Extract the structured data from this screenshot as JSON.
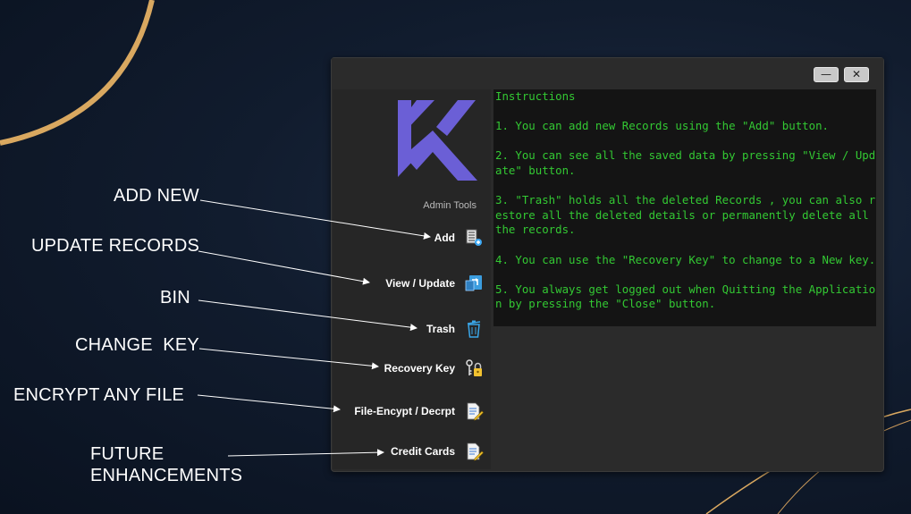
{
  "callouts": {
    "add_new": "ADD NEW",
    "update_records": "UPDATE RECORDS",
    "bin": "BIN",
    "change_key": "CHANGE  KEY",
    "encrypt_any_file": "ENCRYPT ANY FILE",
    "future_enhancements": "FUTURE ENHANCEMENTS"
  },
  "window": {
    "minimize_label": "—",
    "close_label": "✕"
  },
  "sidebar": {
    "logo_icon": "k-logo-icon",
    "admin_label": "Admin Tools",
    "items": [
      {
        "label": "Add",
        "icon": "add-record-icon"
      },
      {
        "label": "View / Update",
        "icon": "view-update-icon"
      },
      {
        "label": "Trash",
        "icon": "trash-icon"
      },
      {
        "label": "Recovery Key",
        "icon": "key-lock-icon"
      },
      {
        "label": "File-Encypt / Decrpt",
        "icon": "file-edit-icon"
      },
      {
        "label": "Credit Cards",
        "icon": "file-edit-icon"
      }
    ]
  },
  "instructions": {
    "heading": "Instructions",
    "lines": [
      "1. You can add new Records using the \"Add\" button.",
      "2. You can see all the saved data by pressing \"View / Update\" button.",
      "3. \"Trash\" holds all the deleted Records , you can also restore all the deleted details or permanently delete all the records.",
      "4. You can use the \"Recovery Key\" to change to a New key.",
      "5. You always get logged out when Quitting the Application by pressing the \"Close\" button."
    ]
  },
  "colors": {
    "terminal_text": "#33c933",
    "logo": "#6b5fd6",
    "accent_gold": "#d9a860"
  }
}
